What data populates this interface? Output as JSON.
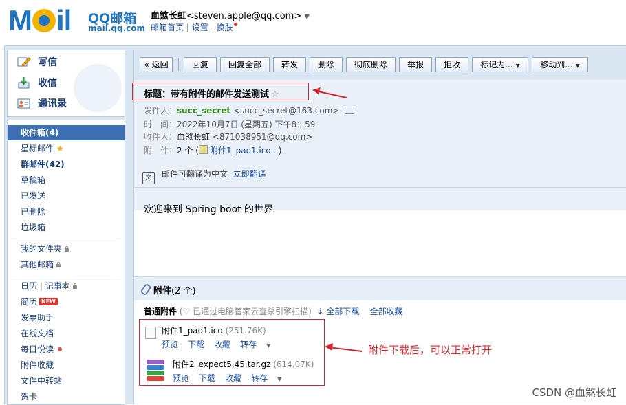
{
  "header": {
    "brand_cn": "QQ邮箱",
    "brand_domain": "mail.qq.com",
    "user_name": "血煞长虹",
    "user_email": "<steven.apple@qq.com>",
    "caret": "▼",
    "nav_home": "邮箱首页",
    "nav_sep": " | ",
    "nav_settings": "设置",
    "nav_dash": " - ",
    "nav_skin": "换肤"
  },
  "actions": {
    "write": "写信",
    "receive": "收信",
    "contacts": "通讯录"
  },
  "folders": {
    "inbox": "收件箱(4)",
    "starred": "星标邮件",
    "group": "群邮件(42)",
    "drafts": "草稿箱",
    "sent": "已发送",
    "deleted": "已删除",
    "spam": "垃圾箱",
    "my_folders": "我的文件夹",
    "other_mail": "其他邮箱",
    "calendar": "日历",
    "notes": "记事本",
    "resume": "简历",
    "resume_badge": "NEW",
    "invoice": "发票助手",
    "docs": "在线文档",
    "daily": "每日悦读",
    "att_fav": "附件收藏",
    "transfer": "文件中转站",
    "card": "贺卡"
  },
  "toolbar": {
    "back": "« 返回",
    "reply": "回复",
    "reply_all": "回复全部",
    "forward": "转发",
    "delete": "删除",
    "perm_delete": "彻底删除",
    "report": "举报",
    "reject": "拒收",
    "mark_as": "标记为...",
    "move_to": "移动到...",
    "drop_arrow": "▼"
  },
  "mail": {
    "subject_label": "标题：",
    "subject": "带有附件的邮件发送测试",
    "star": "☆",
    "from_label": "发件人：",
    "from_name": "succ_secret",
    "from_addr": " <succ_secret@163.com>",
    "time_label": "时　间：",
    "time": "2022年10月7日 (星期五) 下午8：59",
    "to_label": "收件人：",
    "to_name": "血煞长虹",
    "to_addr": " <871038951@qq.com>",
    "att_label": "附　件：",
    "att_count": "2 个 (",
    "att_first": "附件1_pao1.ico...",
    "att_close": ")",
    "translate_text": "邮件可翻译为中文",
    "translate_link": "立即翻译",
    "body": "欢迎来到 Spring boot 的世界"
  },
  "attachments": {
    "title": "附件",
    "count": "(2 个)",
    "section": "普通附件",
    "scan_note": "(♡ 已通过电脑管家云查杀引擎扫描)",
    "download_all": "⇣ 全部下载",
    "save_all": "全部收藏",
    "files": [
      {
        "name": "附件1_pao1.ico",
        "size": "(251.76K)"
      },
      {
        "name": "附件2_expect5.45.tar.gz",
        "size": "(614.07K)"
      }
    ],
    "file_actions": {
      "preview": "预览",
      "download": "下载",
      "collect": "收藏",
      "save": "转存",
      "tri": "▼"
    }
  },
  "annotation": "附件下载后，可以正常打开",
  "watermark": "CSDN @血煞长虹",
  "colors": {
    "accent": "#1f74c4",
    "selected": "#3d6fb3",
    "annotation_red": "#d9262c",
    "sender_green": "#3c8a1a"
  }
}
